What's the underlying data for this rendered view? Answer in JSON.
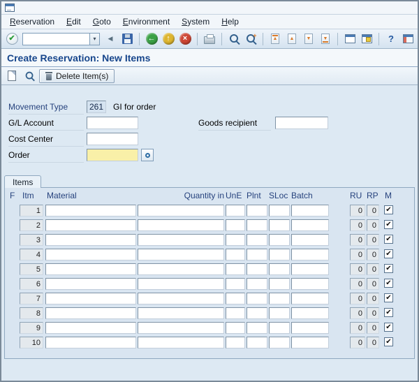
{
  "window": {
    "title": "Create Reservation: New Items"
  },
  "menu": {
    "items": [
      "Reservation",
      "Edit",
      "Goto",
      "Environment",
      "System",
      "Help"
    ]
  },
  "toolbar": {
    "command_value": ""
  },
  "app_toolbar": {
    "delete_button_label": "Delete Item(s)"
  },
  "form": {
    "movement_type_label": "Movement Type",
    "movement_type_value": "261",
    "movement_type_text": "GI for order",
    "gl_account_label": "G/L Account",
    "gl_account_value": "",
    "goods_recipient_label": "Goods recipient",
    "goods_recipient_value": "",
    "cost_center_label": "Cost Center",
    "cost_center_value": "",
    "order_label": "Order",
    "order_value": ""
  },
  "items_panel": {
    "tab_label": "Items",
    "columns": [
      "F",
      "Itm",
      "Material",
      "Quantity in",
      "UnE",
      "Plnt",
      "SLoc",
      "Batch",
      "RU",
      "RP",
      "M"
    ],
    "rows": [
      {
        "itm": "1",
        "material": "",
        "quantity": "",
        "une": "",
        "plnt": "",
        "sloc": "",
        "batch": "",
        "ru": "0",
        "rp": "0",
        "m": true
      },
      {
        "itm": "2",
        "material": "",
        "quantity": "",
        "une": "",
        "plnt": "",
        "sloc": "",
        "batch": "",
        "ru": "0",
        "rp": "0",
        "m": true
      },
      {
        "itm": "3",
        "material": "",
        "quantity": "",
        "une": "",
        "plnt": "",
        "sloc": "",
        "batch": "",
        "ru": "0",
        "rp": "0",
        "m": true
      },
      {
        "itm": "4",
        "material": "",
        "quantity": "",
        "une": "",
        "plnt": "",
        "sloc": "",
        "batch": "",
        "ru": "0",
        "rp": "0",
        "m": true
      },
      {
        "itm": "5",
        "material": "",
        "quantity": "",
        "une": "",
        "plnt": "",
        "sloc": "",
        "batch": "",
        "ru": "0",
        "rp": "0",
        "m": true
      },
      {
        "itm": "6",
        "material": "",
        "quantity": "",
        "une": "",
        "plnt": "",
        "sloc": "",
        "batch": "",
        "ru": "0",
        "rp": "0",
        "m": true
      },
      {
        "itm": "7",
        "material": "",
        "quantity": "",
        "une": "",
        "plnt": "",
        "sloc": "",
        "batch": "",
        "ru": "0",
        "rp": "0",
        "m": true
      },
      {
        "itm": "8",
        "material": "",
        "quantity": "",
        "une": "",
        "plnt": "",
        "sloc": "",
        "batch": "",
        "ru": "0",
        "rp": "0",
        "m": true
      },
      {
        "itm": "9",
        "material": "",
        "quantity": "",
        "une": "",
        "plnt": "",
        "sloc": "",
        "batch": "",
        "ru": "0",
        "rp": "0",
        "m": true
      },
      {
        "itm": "10",
        "material": "",
        "quantity": "",
        "une": "",
        "plnt": "",
        "sloc": "",
        "batch": "",
        "ru": "0",
        "rp": "0",
        "m": true
      }
    ]
  },
  "icons": {
    "enter": "✔",
    "dropdown": "▾",
    "hide_command": "◀",
    "back": "←",
    "exit": "↑",
    "cancel": "×",
    "find_next_plus": "+",
    "first_page": "▲",
    "prev_page": "▲",
    "next_page": "▼",
    "last_page": "▼",
    "help": "?",
    "check": "✔"
  },
  "colors": {
    "title_text": "#17468c",
    "label_blue": "#26427d",
    "field_yellow": "#f9f0a8",
    "readonly_field_bg": "#d5e3f0",
    "panel_bg": "#d9e5f1",
    "toolbar_bg": "#d5e3f0"
  }
}
